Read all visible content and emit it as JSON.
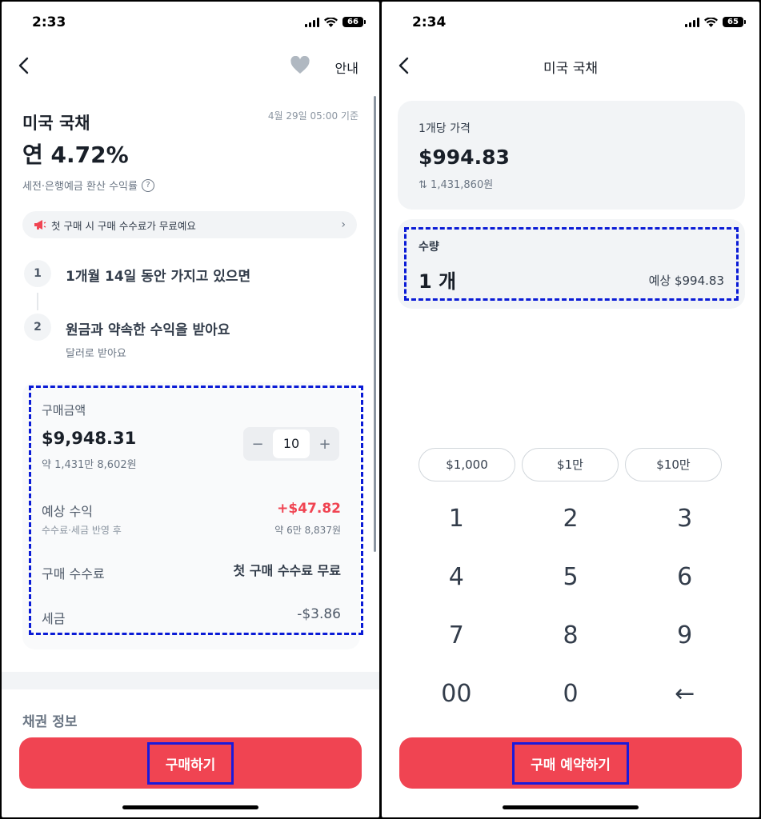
{
  "left": {
    "status": {
      "time": "2:33",
      "battery": "66"
    },
    "nav": {
      "guide": "안내"
    },
    "bond": {
      "name": "미국 국채",
      "as_of": "4월 29일 05:00 기준",
      "rate": "연 4.72%",
      "rate_note": "세전·은행예금 환산 수익률"
    },
    "promo": {
      "text": "첫 구매 시 구매 수수료가 무료예요"
    },
    "steps": [
      {
        "num": "1",
        "text": "1개월 14일 동안 가지고 있으면"
      },
      {
        "num": "2",
        "text": "원금과 약속한 수익을 받아요",
        "sub": "달러로 받아요"
      }
    ],
    "purchase": {
      "label": "구매금액",
      "amount": "$9,948.31",
      "krw": "약 1,431만 8,602원",
      "quantity": "10",
      "minus": "−",
      "plus": "+"
    },
    "expected": {
      "label": "예상 수익",
      "sub": "수수료·세금 반영 후",
      "value": "+$47.82",
      "krw": "약 6만 8,837원"
    },
    "fee": {
      "label": "구매 수수료",
      "value": "첫 구매 수수료 무료"
    },
    "tax": {
      "label": "세금",
      "value": "-$3.86"
    },
    "section_title": "채권 정보",
    "cta": "구매하기"
  },
  "right": {
    "status": {
      "time": "2:34",
      "battery": "65"
    },
    "nav": {
      "title": "미국 국채"
    },
    "unit_price": {
      "label": "1개당 가격",
      "price": "$994.83",
      "krw": "1,431,860원"
    },
    "quantity": {
      "label": "수량",
      "value": "1 개",
      "estimate": "예상 $994.83"
    },
    "chips": [
      "$1,000",
      "$1만",
      "$10만"
    ],
    "keys": [
      "1",
      "2",
      "3",
      "4",
      "5",
      "6",
      "7",
      "8",
      "9",
      "00",
      "0",
      "←"
    ],
    "cta": "구매 예약하기"
  },
  "colors": {
    "accent": "#f04452",
    "positive": "#f04452",
    "highlight": "#0a1bd6"
  },
  "icons": [
    "back-arrow-icon",
    "heart-icon",
    "megaphone-icon",
    "chevron-right-icon",
    "question-icon",
    "swap-icon",
    "signal-icon",
    "wifi-icon",
    "battery-icon"
  ]
}
